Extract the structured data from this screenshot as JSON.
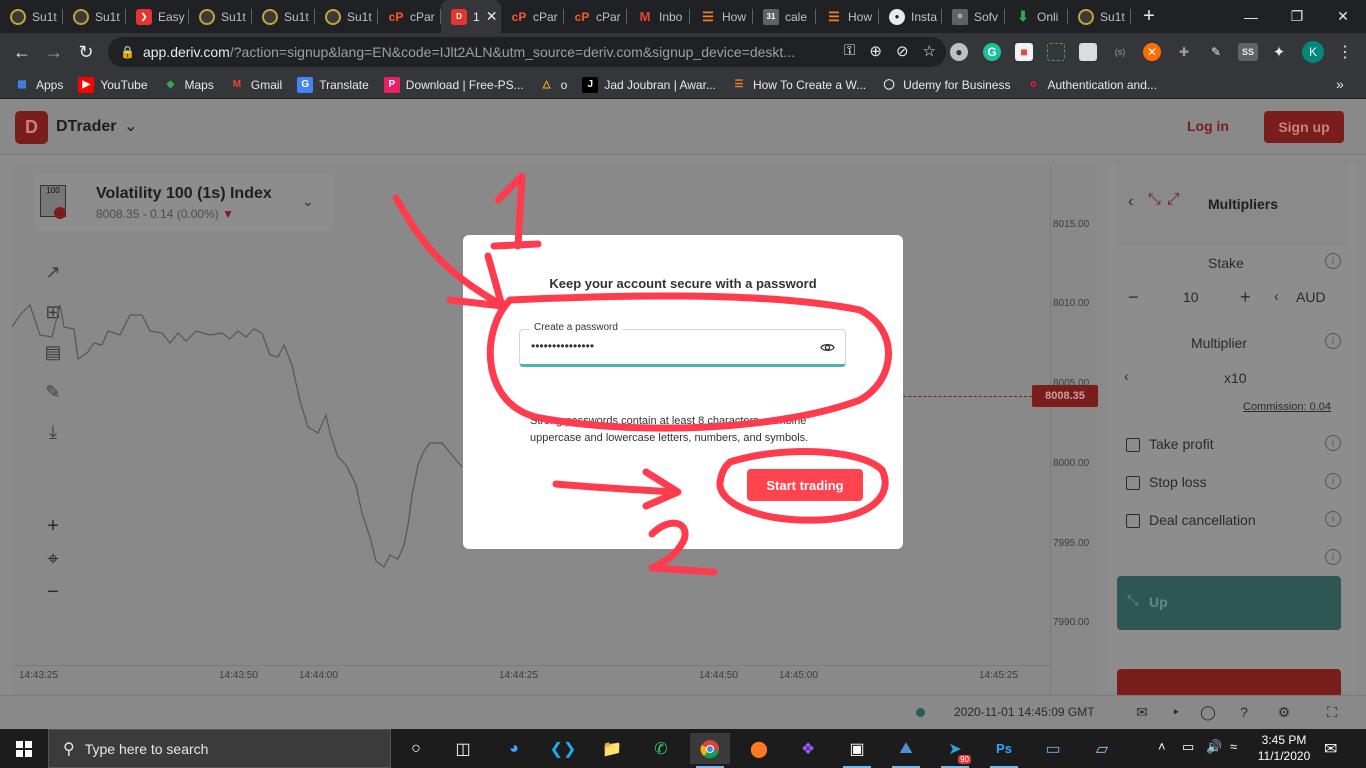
{
  "browser": {
    "tabs": [
      {
        "label": "Su1t",
        "icon": "su-icon"
      },
      {
        "label": "Su1t",
        "icon": "su-icon"
      },
      {
        "label": "Easy",
        "icon": "easy-icon"
      },
      {
        "label": "Su1t",
        "icon": "su-icon"
      },
      {
        "label": "Su1t",
        "icon": "su-icon"
      },
      {
        "label": "Su1t",
        "icon": "su-icon"
      },
      {
        "label": "cPar",
        "icon": "cpanel-icon"
      },
      {
        "label": "1",
        "icon": "deriv-icon",
        "active": true
      },
      {
        "label": "cPar",
        "icon": "cpanel-icon"
      },
      {
        "label": "cPar",
        "icon": "cpanel-icon"
      },
      {
        "label": "Inbo",
        "icon": "gmail-icon"
      },
      {
        "label": "How",
        "icon": "stackoverflow-icon"
      },
      {
        "label": "cale",
        "icon": "calendar-icon"
      },
      {
        "label": "How",
        "icon": "stackoverflow-icon"
      },
      {
        "label": "Insta",
        "icon": "github-icon"
      },
      {
        "label": "Sofv",
        "icon": "sofv-icon"
      },
      {
        "label": "Onli",
        "icon": "download-icon"
      },
      {
        "label": "Su1t",
        "icon": "su-icon"
      }
    ],
    "url_domain": "app.deriv.com",
    "url_rest": "/?action=signup&lang=EN&code=IJlt2ALN&utm_source=deriv.com&signup_device=deskt...",
    "profile_initial": "K",
    "ss_badge": "SS",
    "bookmarks": [
      {
        "label": "Apps",
        "icon": "apps-grid-icon"
      },
      {
        "label": "YouTube",
        "icon": "youtube-icon"
      },
      {
        "label": "Maps",
        "icon": "maps-icon"
      },
      {
        "label": "Gmail",
        "icon": "gmail-icon"
      },
      {
        "label": "Translate",
        "icon": "translate-icon"
      },
      {
        "label": "Download | Free-PS...",
        "icon": "psd-icon"
      },
      {
        "label": "o",
        "icon": "prism-icon"
      },
      {
        "label": "Jad Joubran | Awar...",
        "icon": "jad-icon"
      },
      {
        "label": "How To Create a W...",
        "icon": "stackoverflow-icon"
      },
      {
        "label": "Udemy for Business",
        "icon": "globe-icon"
      },
      {
        "label": "Authentication and...",
        "icon": "opera-icon"
      }
    ],
    "bookmarks_more": "»"
  },
  "app": {
    "brand": "DTrader",
    "login_label": "Log in",
    "signup_label": "Sign up",
    "market": {
      "icon_label": "100",
      "name": "Volatility 100 (1s) Index",
      "price": "8008.35 - 0.14 (0.00%)",
      "down_arrow": "▼"
    },
    "price_ticks": [
      "8015.00",
      "8010.00",
      "8005.00",
      "8000.00",
      "7995.00",
      "7990.00"
    ],
    "current_price": "8008.35",
    "time_ticks": [
      "14:43:25",
      "14:43:50",
      "14:44:00",
      "14:44:25",
      "14:44:50",
      "14:45:00",
      "14:45:25"
    ],
    "server_time": "2020-11-01 14:45:09 GMT",
    "trade_panel": {
      "trade_type": "Multipliers",
      "stake_label": "Stake",
      "stake_value": "10",
      "currency": "AUD",
      "minus": "−",
      "plus": "+",
      "multiplier_label": "Multiplier",
      "multiplier_value": "x10",
      "commission": "Commission: 0.04",
      "take_profit": "Take profit",
      "stop_loss": "Stop loss",
      "deal_cancellation": "Deal cancellation",
      "up_label": "Up"
    }
  },
  "modal": {
    "title": "Keep your account secure with a password",
    "password_label": "Create a password",
    "password_value": "•••••••••••••••",
    "hint": "Strong passwords contain at least 8 characters, combine uppercase and lowercase letters, numbers, and symbols.",
    "start_button": "Start trading"
  },
  "annotations": {
    "marker_1": "1",
    "marker_2": "2",
    "color": "#ff3b4e"
  },
  "taskbar": {
    "search_placeholder": "Type here to search",
    "time": "3:45 PM",
    "date": "11/1/2020",
    "telegram_badge": "90"
  }
}
